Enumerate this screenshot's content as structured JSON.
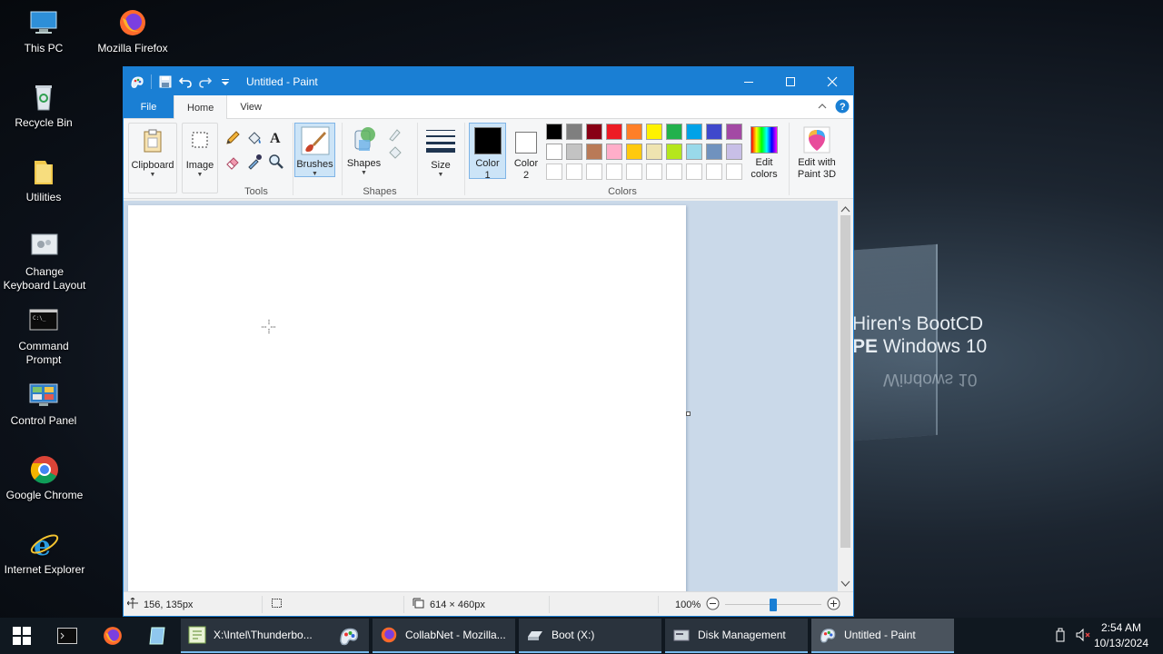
{
  "desktop": {
    "icons": [
      {
        "label": "This PC"
      },
      {
        "label": "Mozilla Firefox"
      },
      {
        "label": "Recycle Bin"
      },
      {
        "label": "Utilities"
      },
      {
        "label": "Change Keyboard Layout"
      },
      {
        "label": "Command Prompt"
      },
      {
        "label": "Control Panel"
      },
      {
        "label": "Google Chrome"
      },
      {
        "label": "Internet Explorer"
      }
    ],
    "wallpaper_line1": "Hiren's BootCD",
    "wallpaper_line2": "PE Windows 10",
    "wallpaper_reflection": "Windows 10"
  },
  "paint": {
    "title": "Untitled - Paint",
    "tabs": {
      "file": "File",
      "home": "Home",
      "view": "View"
    },
    "clipboard": {
      "label": "Clipboard"
    },
    "image": {
      "label": "Image"
    },
    "tools_group": "Tools",
    "brushes": {
      "label": "Brushes"
    },
    "shapes": {
      "label": "Shapes"
    },
    "shapes_group": "Shapes",
    "size": {
      "label": "Size"
    },
    "color1": {
      "line1": "Color",
      "line2": "1"
    },
    "color2": {
      "line1": "Color",
      "line2": "2"
    },
    "colors_group": "Colors",
    "edit_colors": {
      "line1": "Edit",
      "line2": "colors"
    },
    "paint3d": {
      "line1": "Edit with",
      "line2": "Paint 3D"
    },
    "palette_row1": [
      "#000000",
      "#7f7f7f",
      "#880015",
      "#ed1c24",
      "#ff7f27",
      "#fff200",
      "#22b14c",
      "#00a2e8",
      "#3f48cc",
      "#a349a4"
    ],
    "palette_row2": [
      "#ffffff",
      "#c3c3c3",
      "#b97a57",
      "#ffaec9",
      "#ffc90e",
      "#efe4b0",
      "#b5e61d",
      "#99d9ea",
      "#7092be",
      "#c8bfe7"
    ],
    "status": {
      "cursor_pos": "156, 135px",
      "canvas_size": "614 × 460px",
      "zoom": "100%"
    }
  },
  "taskbar": {
    "buttons": [
      {
        "label": "X:\\Intel\\Thunderbo..."
      },
      {
        "label": "CollabNet - Mozilla..."
      },
      {
        "label": "Boot (X:)"
      },
      {
        "label": "Disk Management"
      },
      {
        "label": "Untitled - Paint"
      }
    ],
    "time": "2:54 AM",
    "date": "10/13/2024"
  }
}
